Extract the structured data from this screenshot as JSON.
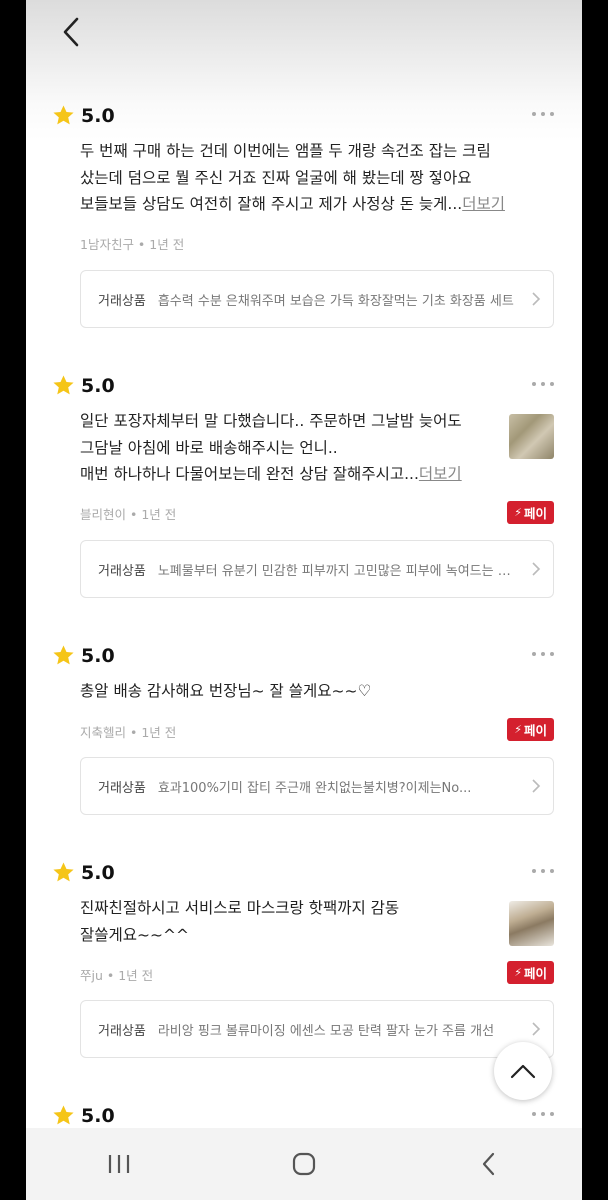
{
  "reviews": [
    {
      "rating": "5.0",
      "lines": [
        "두 번째 구매 하는 건데 이번에는 앰플 두 개랑 속건조 잡는 크림",
        "샀는데 덤으로 뭘 주신 거죠 진짜 얼굴에 해 봤는데 짱 젛아요",
        "보들보들 상담도 여전히 잘해 주시고 제가 사정상 돈 늦게..."
      ],
      "see_more": "더보기",
      "meta": "1남자친구 • 1년 전",
      "product_label": "거래상품",
      "product_name": "흡수력 수분 은채워주며 보습은 가득 화장잘먹는 기초 화장품 세트"
    },
    {
      "rating": "5.0",
      "lines": [
        "일단 포장자체부터 말 다했습니다.. 주문하면 그날밤 늦어도",
        "그담날 아침에 바로 배송해주시는 언니..",
        "매번 하나하나 다물어보는데 완전 상담 잘해주시고..."
      ],
      "see_more": "더보기",
      "meta": "블리현이 • 1년 전",
      "pay_badge": "페이",
      "product_label": "거래상품",
      "product_name": "노폐물부터 유분기 민감한 피부까지 고민많은 피부에 녹여드는 세트"
    },
    {
      "rating": "5.0",
      "lines": [
        "총알 배송 감사해요 번장님~ 잘 쓸게요~~♡"
      ],
      "meta": "지축헬리 • 1년 전",
      "pay_badge": "페이",
      "product_label": "거래상품",
      "product_name": "효과100%기미 잡티 주근깨 완치없는불치병?이제는No..."
    },
    {
      "rating": "5.0",
      "lines": [
        "진짜친절하시고 서비스로 마스크랑 핫팩까지  감동",
        "잘쓸게요~~^^"
      ],
      "meta": "쭈ju • 1년 전",
      "pay_badge": "페이",
      "product_label": "거래상품",
      "product_name": "라비앙 핑크 볼류마이징 에센스 모공 탄력 팔자 눈가 주름 개선"
    },
    {
      "rating": "5.0"
    }
  ],
  "icons": {
    "back": "chevron-left-icon",
    "more": "more-dots-icon",
    "star": "star-icon",
    "scroll_top": "chevron-up-icon",
    "nav_recent": "recent-apps-icon",
    "nav_home": "home-icon",
    "nav_back": "back-icon"
  },
  "colors": {
    "star": "#f5c518",
    "pay_badge": "#d4202e"
  }
}
